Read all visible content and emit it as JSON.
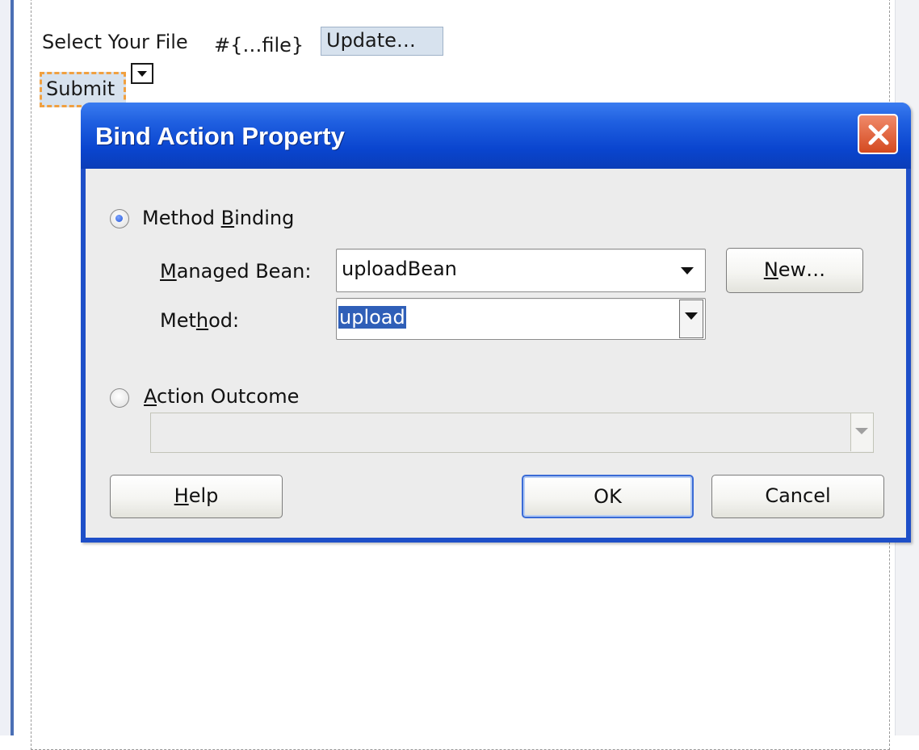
{
  "form": {
    "select_label": "Select Your File",
    "expression": "#{…file}",
    "update_button": "Update…",
    "submit_button": "Submit"
  },
  "dialog": {
    "title": "Bind Action Property",
    "method_binding_pre": "Method ",
    "method_binding_ul": "B",
    "method_binding_post": "inding",
    "method_binding_selected": true,
    "managed_bean_ul": "M",
    "managed_bean_post": "anaged Bean:",
    "managed_bean_value": "uploadBean",
    "new_button_ul": "N",
    "new_button_post": "ew…",
    "method_pre": "Met",
    "method_ul": "h",
    "method_post": "od:",
    "method_value": "upload",
    "action_outcome_ul": "A",
    "action_outcome_post": "ction Outcome",
    "action_outcome_selected": false,
    "action_outcome_value": "",
    "help_button_ul": "H",
    "help_button_post": "elp",
    "ok_button": "OK",
    "cancel_button": "Cancel"
  },
  "colors": {
    "titlebar": "#0a45cf",
    "selection": "#2f5fb8",
    "close_button": "#d44a20",
    "focus_dash": "#f0a040"
  }
}
